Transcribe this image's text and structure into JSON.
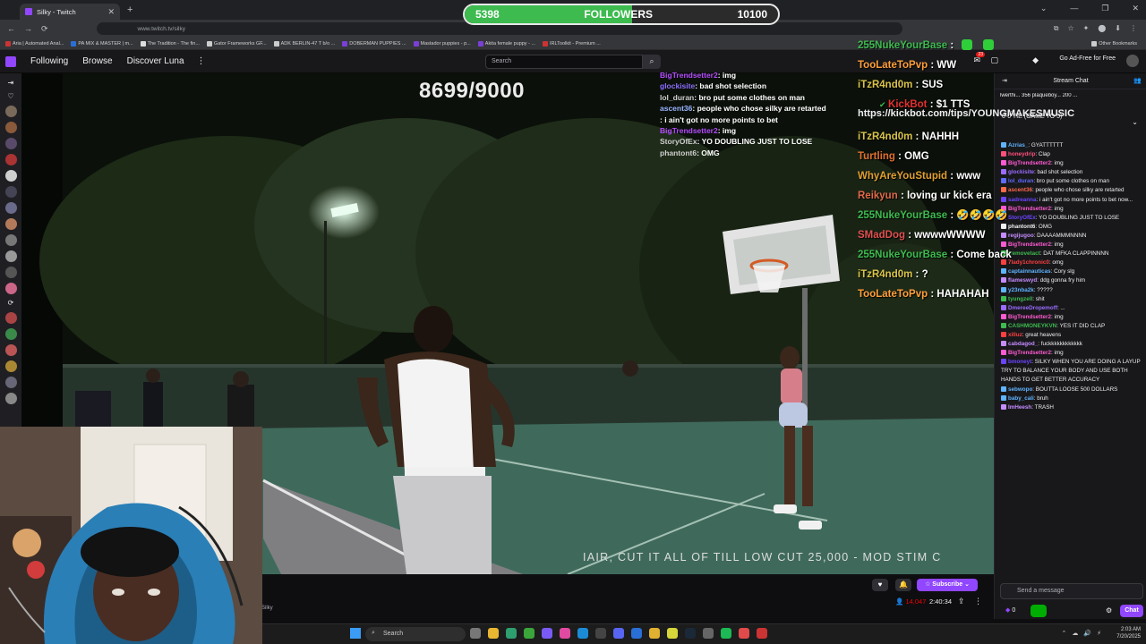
{
  "browser": {
    "tab_title": "Silky - Twitch",
    "tab_close": "✕",
    "new_tab": "+",
    "url": "www.twitch.tv/silky",
    "window_controls": [
      "⌄",
      "—",
      "❐",
      "✕"
    ],
    "nav_icons": [
      "←",
      "→",
      "⟳"
    ],
    "toolbar_icons": [
      "⧉",
      "☆",
      "✦",
      "⬤",
      "⬇",
      "⋮"
    ],
    "bookmarks": [
      "Aria | Automated Anal...",
      "PA MIX & MASTER | m...",
      "The Tradition - The fin...",
      "Gator Frameworks GF...",
      "ADK BERLIN-47 T b/o ...",
      "DOBERMAN PUPPIES ...",
      "Mastador puppies - p...",
      "Akita female puppy - ...",
      "IRLToolkit - Premium ..."
    ],
    "other_bookmarks": "Other Bookmarks"
  },
  "follow_goal": {
    "current": "5398",
    "label": "FOLLOWERS",
    "target": "10100",
    "progress_fraction": 0.534
  },
  "twitch_nav": {
    "following": "Following",
    "browse": "Browse",
    "discover": "Discover Luna",
    "more": "⋮",
    "search_placeholder": "Search",
    "search_icon": "⌕",
    "notif_count": "23",
    "ad_free": "Go Ad-Free for Free",
    "icons": [
      "✉",
      "▢",
      "◆"
    ]
  },
  "side_rail_icons": [
    "⇥",
    "♡",
    "⟳",
    "⌂"
  ],
  "video": {
    "counter": "8699/9000",
    "ticker": "IAIR, CUT IT ALL OF TILL LOW CUT 25,000 - MOD STIM C"
  },
  "overlay_chat_small": [
    {
      "user": "BigTrendsetter2",
      "text": ": img",
      "color": "#b44aff"
    },
    {
      "user": "glockisite",
      "text": ": bad shot selection",
      "color": "#8a6cff"
    },
    {
      "user": "lol_duran",
      "text": ": bro put some clothes on man",
      "color": "#cfcfcf"
    },
    {
      "user": "ascent36",
      "text": ": people who chose silky are retarted",
      "color": "#9ab4ff"
    },
    {
      "user": "                 ",
      "text": ": i ain't got no more points to bet",
      "color": "#6b44ff"
    },
    {
      "user": "BigTrendsetter2",
      "text": ": img",
      "color": "#b44aff"
    },
    {
      "user": "StoryOfEx",
      "text": ": YO DOUBLING JUST TO LOSE",
      "color": "#cfcfcf"
    },
    {
      "user": "phantont6",
      "text": ": OMG",
      "color": "#cfcfcf"
    }
  ],
  "overlay_chat_big": [
    {
      "user": "255NukeYourBase",
      "text": " :",
      "color": "#3dbb4f"
    },
    {
      "user": "TooLateToPvp",
      "text": " : WW",
      "color": "#ff9f3a"
    },
    {
      "user": "iTzR4nd0m",
      "text": " : SUS",
      "color": "#d8c34a"
    },
    {
      "user": "KickBot",
      "text": " : $1 TTS",
      "color": "#e53030",
      "kick": true
    },
    {
      "user": "",
      "text": "https://kickbot.com/tips/YOUNGMAKESMUSIC",
      "color": "#fff"
    },
    {
      "user": "iTzR4nd0m",
      "text": " : NAHHH",
      "color": "#d8c34a"
    },
    {
      "user": "Turtling",
      "text": " : OMG",
      "color": "#e07030"
    },
    {
      "user": "WhyAreYouStupid",
      "text": " : www",
      "color": "#e0a030"
    },
    {
      "user": "Reikyun",
      "text": " : loving ur kick era",
      "color": "#e06a4a"
    },
    {
      "user": "255NukeYourBase",
      "text": " : 🤣🤣🤣🤣",
      "color": "#3dbb4f"
    },
    {
      "user": "SMadDog",
      "text": " : wwwwWWWW",
      "color": "#e05050"
    },
    {
      "user": "255NukeYourBase",
      "text": " : Come back",
      "color": "#3dbb4f"
    },
    {
      "user": "iTzR4nd0m",
      "text": " : ?",
      "color": "#d8c34a"
    },
    {
      "user": "TooLateToPvp",
      "text": " : HAHAHAH",
      "color": "#ff9f3a"
    }
  ],
  "player": {
    "subscribe": "☆ Subscribe ⌄",
    "heart": "♥",
    "bell": "🔔",
    "viewers": "14,047",
    "uptime": "2:40:34",
    "share": "⇪",
    "more": "⋮",
    "channel": "Silky"
  },
  "chat": {
    "title": "Stream Chat",
    "collapse": "⇥",
    "users_icon": "👥",
    "leaderboard": "lwerthi... 356  plaqueboy... 200  ...",
    "prediction_top": "... ...",
    "prediction": "0-0 TIE (GAME TO 5)",
    "prediction_chev": "⌄",
    "messages": [
      {
        "user": "Azrias_",
        "text": ": GYATTTTTT",
        "color": "#5fb4ff"
      },
      {
        "user": "honeydrip",
        "text": ": Clap",
        "color": "#ff4f7a"
      },
      {
        "user": "BigTrendsetter2",
        "text": ": img",
        "color": "#ff5ad1"
      },
      {
        "user": "glockisite",
        "text": ": bad shot selection",
        "color": "#9a6cff"
      },
      {
        "user": "lol_duran",
        "text": ": bro put some clothes on man",
        "color": "#5f6bff"
      },
      {
        "user": "ascent36",
        "text": ": people who chose silky are retarted",
        "color": "#ff6a4a"
      },
      {
        "user": "sadreanna",
        "text": ": i ain't got no more points to bet now...",
        "color": "#6b44ff"
      },
      {
        "user": "BigTrendsetter2",
        "text": ": img",
        "color": "#ff5ad1"
      },
      {
        "user": "StoryOfEx",
        "text": ": YO DOUBLING JUST TO LOSE",
        "color": "#6b44ff"
      },
      {
        "user": "phantont6",
        "text": ": OMG",
        "color": "#efeff1"
      },
      {
        "user": "regijugoo",
        "text": ": DAAAAMMMNNNN",
        "color": "#c68cff"
      },
      {
        "user": "BigTrendsetter2",
        "text": ": img",
        "color": "#ff5ad1"
      },
      {
        "user": "tremovetact",
        "text": ": DAT MFKA CLAPPINNNN",
        "color": "#3dbb4f"
      },
      {
        "user": "7lady1chronic0",
        "text": ": omg",
        "color": "#ff3f3f"
      },
      {
        "user": "captainnauticas",
        "text": ": Cory slg",
        "color": "#5fb4ff"
      },
      {
        "user": "flameswyd",
        "text": ": ddg gonna fry him",
        "color": "#c68cff"
      },
      {
        "user": "y23nba2k",
        "text": ": ?????",
        "color": "#5fb4ff"
      },
      {
        "user": "tyungzell",
        "text": ": shit",
        "color": "#3dbb4f"
      },
      {
        "user": "DmereeDropemoff",
        "text": ": ...",
        "color": "#9a6cff"
      },
      {
        "user": "BigTrendsetter2",
        "text": ": img",
        "color": "#ff5ad1"
      },
      {
        "user": "CASHMONEYKVN",
        "text": ": YES IT DID CLAP",
        "color": "#3dbb4f"
      },
      {
        "user": "xilluz",
        "text": ": great heavens",
        "color": "#ff3f3f"
      },
      {
        "user": "cabdagod_",
        "text": ": fuckkkkkkkkkkkk",
        "color": "#c68cff"
      },
      {
        "user": "BigTrendsetter2",
        "text": ": img",
        "color": "#ff5ad1"
      },
      {
        "user": "bmoneyt",
        "text": ": SILKY WHEN YOU ARE DOING A LAYUP TRY TO BALANCE YOUR BODY AND USE BOTH HANDS TO GET BETTER ACCURACY",
        "color": "#6b44ff"
      },
      {
        "user": "sebwopo",
        "text": ": BOUTTA LOOSE 500 DOLLARS",
        "color": "#5fb4ff"
      },
      {
        "user": "baby_cali",
        "text": ": bruh",
        "color": "#5fb4ff"
      },
      {
        "user": "ImHeesh",
        "text": ": TRASH",
        "color": "#c68cff"
      }
    ],
    "input_placeholder": "Send a message",
    "points": "0",
    "send_label": "Chat",
    "gear": "⚙"
  },
  "taskbar": {
    "search": "Search",
    "time": "2:03 AM",
    "date": "7/20/2025",
    "tray": [
      "⌃",
      "☁",
      "🔊",
      "⚡"
    ]
  },
  "colors": {
    "twitch_purple": "#9146ff",
    "follow_green": "#3dbb4f",
    "live_red": "#eb0400"
  }
}
